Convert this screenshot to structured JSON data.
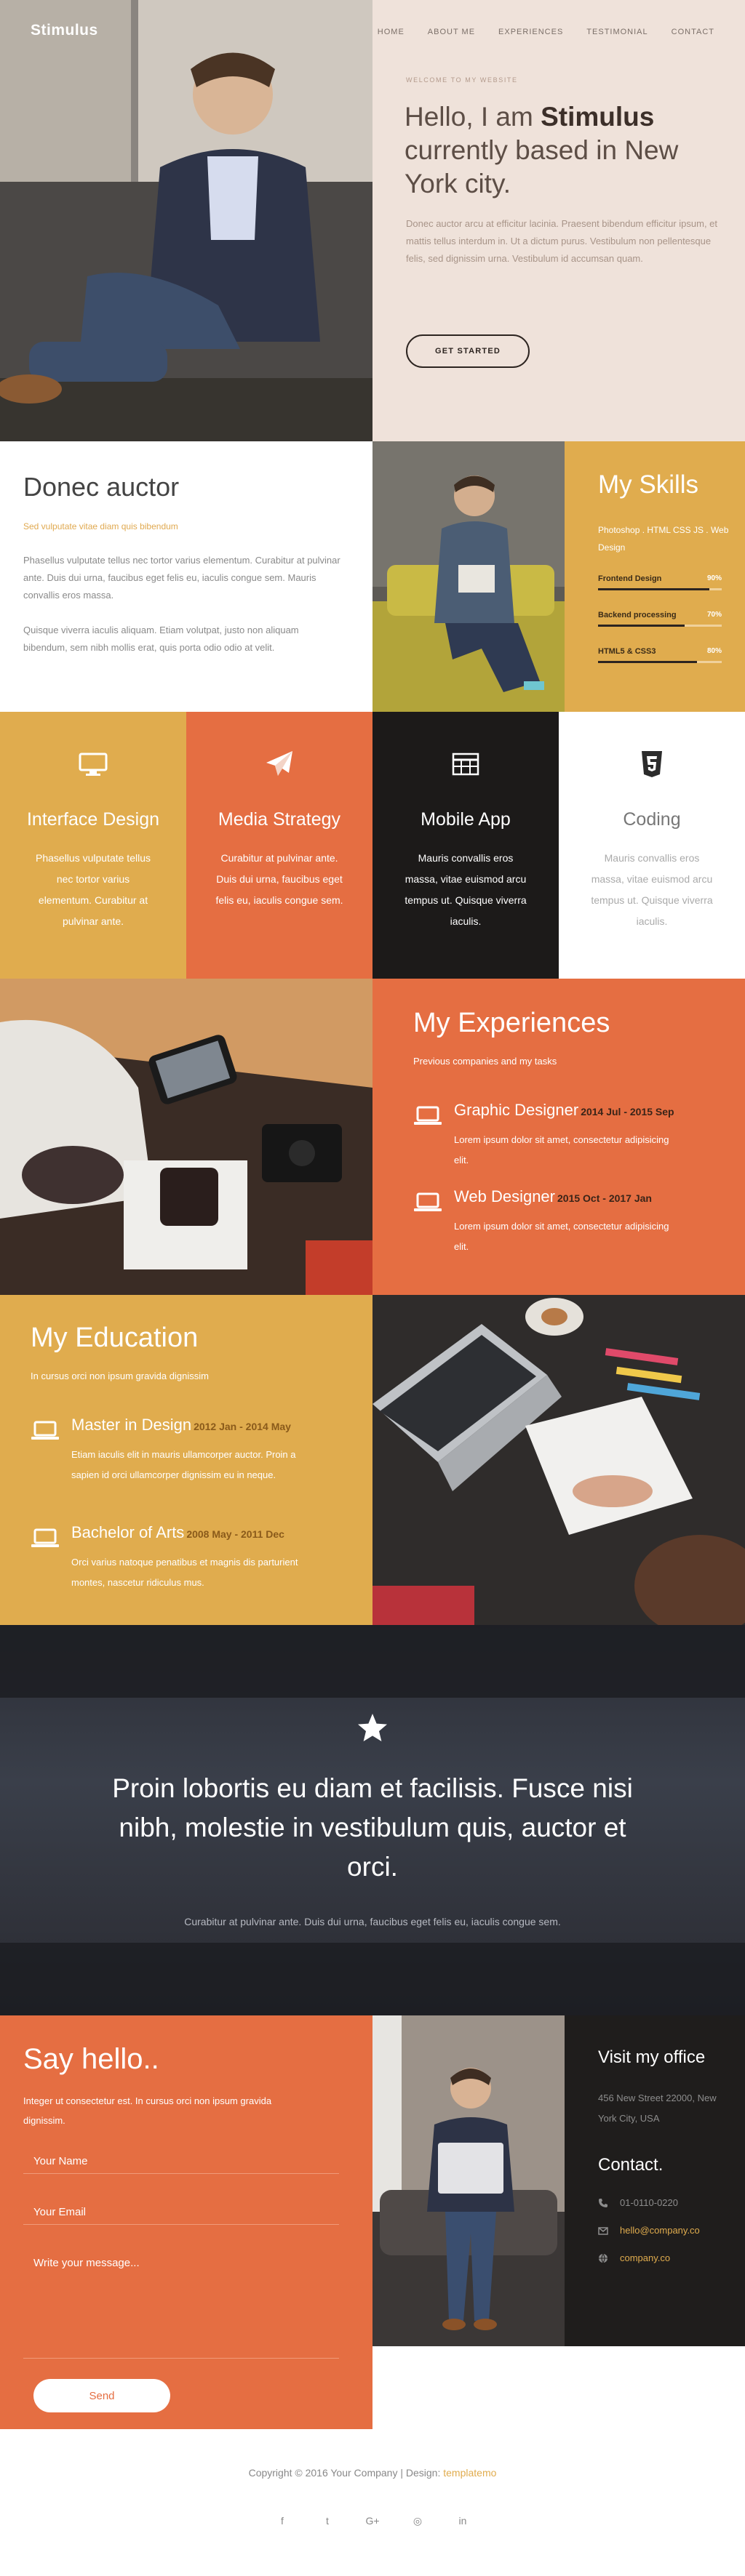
{
  "header": {
    "logo": "Stimulus",
    "nav": [
      "HOME",
      "ABOUT ME",
      "EXPERIENCES",
      "TESTIMONIAL",
      "CONTACT"
    ]
  },
  "hero": {
    "kicker": "WELCOME TO MY WEBSITE",
    "title_pre": "Hello, I am ",
    "title_name": "Stimulus",
    "title_post": " currently based in New York city.",
    "text": "Donec auctor arcu at efficitur lacinia. Praesent bibendum efficitur ipsum, et mattis tellus interdum in. Ut a dictum purus. Vestibulum non pellentesque felis, sed dignissim urna. Vestibulum id accumsan quam.",
    "button": "GET STARTED"
  },
  "about": {
    "title": "Donec auctor",
    "subtitle": "Sed vulputate vitae diam quis bibendum",
    "p1": "Phasellus vulputate tellus nec tortor varius elementum. Curabitur at pulvinar ante. Duis dui urna, faucibus eget felis eu, iaculis congue sem. Mauris convallis eros massa.",
    "p2": "Quisque viverra iaculis aliquam. Etiam volutpat, justo non aliquam bibendum, sem nibh mollis erat, quis porta odio odio at velit."
  },
  "skills": {
    "title": "My Skills",
    "subtitle": "Photoshop . HTML CSS JS . Web Design",
    "items": [
      {
        "name": "Frontend Design",
        "pct_label": "90%",
        "value": 0.9
      },
      {
        "name": "Backend processing",
        "pct_label": "70%",
        "value": 0.7
      },
      {
        "name": "HTML5 & CSS3",
        "pct_label": "80%",
        "value": 0.8
      }
    ]
  },
  "services": [
    {
      "icon": "monitor-icon",
      "title": "Interface Design",
      "text": "Phasellus vulputate tellus nec tortor varius elementum. Curabitur at pulvinar ante."
    },
    {
      "icon": "paper-plane-icon",
      "title": "Media Strategy",
      "text": "Curabitur at pulvinar ante. Duis dui urna, faucibus eget felis eu, iaculis congue sem."
    },
    {
      "icon": "table-grid-icon",
      "title": "Mobile App",
      "text": "Mauris convallis eros massa, vitae euismod arcu tempus ut. Quisque viverra iaculis."
    },
    {
      "icon": "html5-icon",
      "title": "Coding",
      "text": "Mauris convallis eros massa, vitae euismod arcu tempus ut. Quisque viverra iaculis."
    }
  ],
  "experiences": {
    "title": "My Experiences",
    "subtitle": "Previous companies and my tasks",
    "items": [
      {
        "title": "Graphic Designer",
        "date": "2014 Jul - 2015 Sep",
        "text": "Lorem ipsum dolor sit amet, consectetur adipisicing elit."
      },
      {
        "title": "Web Designer",
        "date": "2015 Oct - 2017 Jan",
        "text": "Lorem ipsum dolor sit amet, consectetur adipisicing elit."
      }
    ]
  },
  "education": {
    "title": "My Education",
    "subtitle": "In cursus orci non ipsum gravida dignissim",
    "items": [
      {
        "title": "Master in Design",
        "date": "2012 Jan - 2014 May",
        "text": "Etiam iaculis elit in mauris ullamcorper auctor. Proin a sapien id orci ullamcorper dignissim eu in neque."
      },
      {
        "title": "Bachelor of Arts",
        "date": "2008 May - 2011 Dec",
        "text": "Orci varius natoque penatibus et magnis dis parturient montes, nascetur ridiculus mus."
      }
    ]
  },
  "quote": {
    "text": "Proin lobortis eu diam et facilisis. Fusce nisi nibh, molestie in vestibulum quis, auctor et orci.",
    "caption": "Curabitur at pulvinar ante. Duis dui urna, faucibus eget felis eu, iaculis congue sem."
  },
  "contact": {
    "title": "Say hello..",
    "intro": "Integer ut consectetur est. In cursus orci non ipsum gravida dignissim.",
    "name_placeholder": "Your Name",
    "email_placeholder": "Your Email",
    "message_placeholder": "Write your message...",
    "send": "Send",
    "office_title": "Visit my office",
    "address": "456 New Street 22000, New York City, USA",
    "contact_title": "Contact.",
    "phone": "01-0110-0220",
    "email": "hello@company.co",
    "website": "company.co"
  },
  "footer": {
    "copyright": "Copyright © 2016 Your Company | Design: ",
    "design_link": "templatemo",
    "social": [
      "f",
      "t",
      "G+",
      "◎",
      "in"
    ],
    "social_names": [
      "facebook-icon",
      "twitter-icon",
      "google-plus-icon",
      "dribbble-icon",
      "linkedin-icon"
    ]
  },
  "colors": {
    "mustard": "#e0ac4e",
    "orange": "#e56e42",
    "dark": "#1c1a19",
    "blush": "#efe2da"
  }
}
